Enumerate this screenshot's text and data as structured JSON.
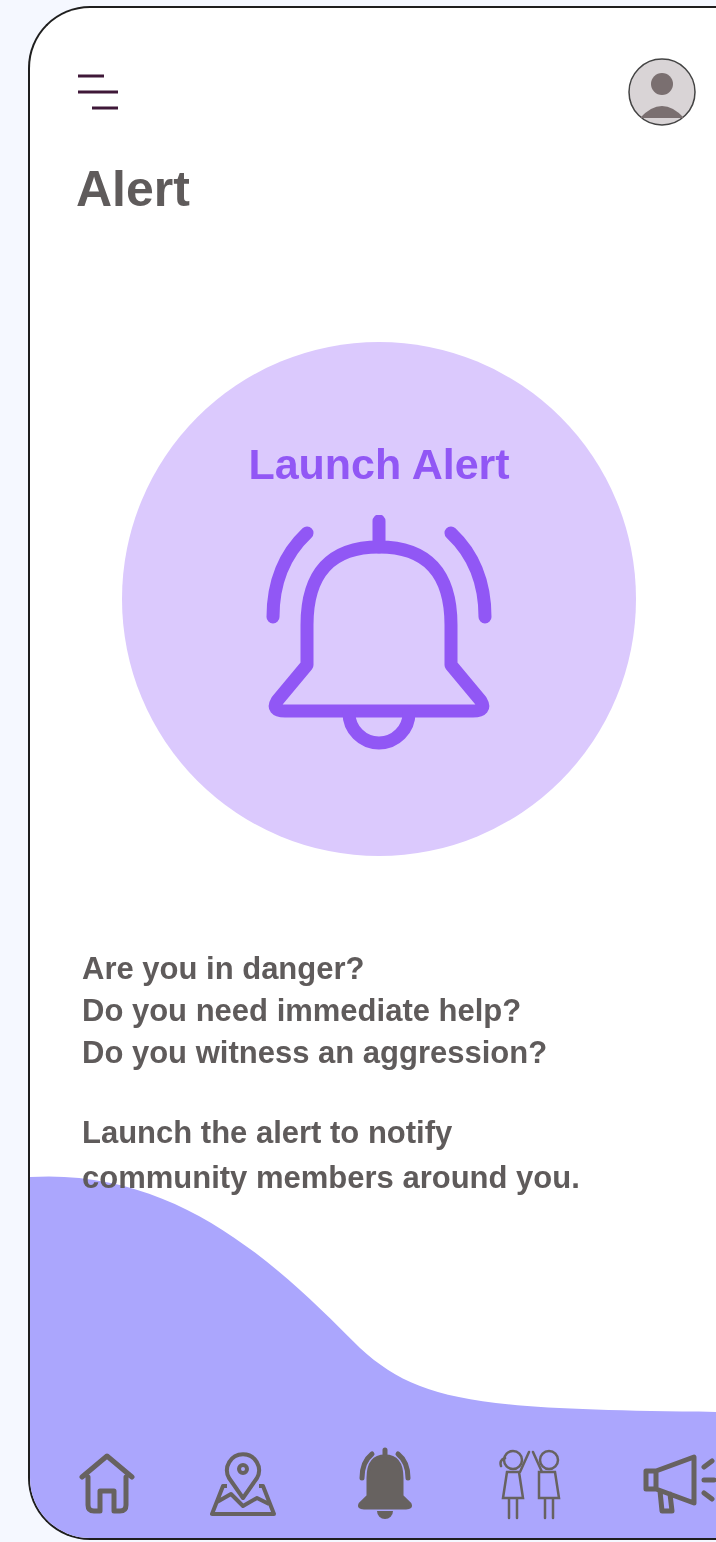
{
  "header": {
    "title": "Alert"
  },
  "alert_button": {
    "label": "Launch Alert"
  },
  "message": {
    "questions": [
      "Are you in danger?",
      "Do you need immediate help?",
      "Do you witness an aggression?"
    ],
    "text": "Launch the alert to notify community members around you."
  },
  "nav": [
    {
      "kind": "home",
      "selected": false
    },
    {
      "kind": "map",
      "selected": false
    },
    {
      "kind": "alert",
      "selected": true
    },
    {
      "kind": "community",
      "selected": false
    },
    {
      "kind": "announce",
      "selected": false
    }
  ]
}
